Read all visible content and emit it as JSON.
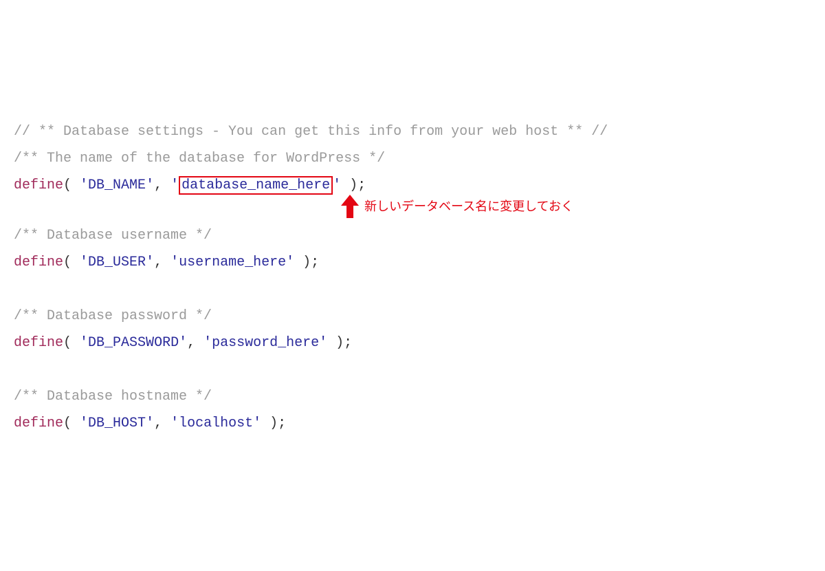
{
  "code": {
    "line1_comment": "// ** Database settings - You can get this info from your web host ** //",
    "line2_comment": "/** The name of the database for WordPress */",
    "define_kw": "define",
    "open": "( ",
    "close": " );",
    "q": "'",
    "comma": ", ",
    "db_name_key": "DB_NAME",
    "db_name_val": "database_name_here",
    "line5_comment": "/** Database username */",
    "db_user_key": "DB_USER",
    "db_user_val": "username_here",
    "line8_comment": "/** Database password */",
    "db_pass_key": "DB_PASSWORD",
    "db_pass_val": "password_here",
    "line11_comment": "/** Database hostname */",
    "db_host_key": "DB_HOST",
    "db_host_val": "localhost"
  },
  "annotation": {
    "text": "新しいデータベース名に変更しておく"
  },
  "colors": {
    "comment": "#9a9a9a",
    "keyword": "#a02a5a",
    "string": "#2a2a9a",
    "highlight": "#e30613"
  }
}
